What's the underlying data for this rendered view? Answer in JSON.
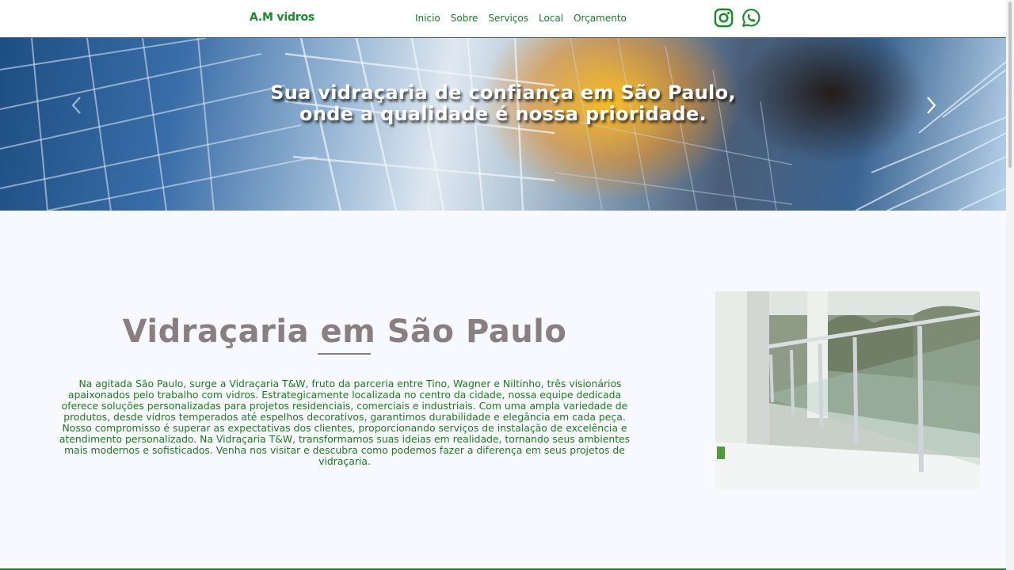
{
  "navbar": {
    "brand": "A.M vidros",
    "links": [
      {
        "label": "Inicio"
      },
      {
        "label": "Sobre"
      },
      {
        "label": "Serviços"
      },
      {
        "label": "Local"
      },
      {
        "label": "Orçamento"
      }
    ],
    "social": [
      {
        "icon": "instagram-icon"
      },
      {
        "icon": "whatsapp-icon"
      }
    ],
    "accent_color": "#1b8a2e"
  },
  "hero": {
    "caption": "Sua vidraçaria de confiança em São Paulo, onde a qualidade é nossa prioridade.",
    "prev_icon": "chevron-left-icon",
    "next_icon": "chevron-right-icon"
  },
  "about": {
    "title": "Vidraçaria em São Paulo",
    "text": "Na agitada São Paulo, surge a Vidraçaria T&W, fruto da parceria entre Tino, Wagner e Niltinho, três visionários apaixonados pelo trabalho com vidros. Estrategicamente localizada no centro da cidade, nossa equipe dedicada oferece soluções personalizadas para projetos residenciais, comerciais e industriais. Com uma ampla variedade de produtos, desde vidros temperados até espelhos decorativos, garantimos durabilidade e elegância em cada peça. Nosso compromisso é superar as expectativas dos clientes, proporcionando serviços de instalação de excelência e atendimento personalizado. Na Vidraçaria T&W, transformamos suas ideias em realidade, tornando seus ambientes mais modernos e sofisticados. Venha nos visitar e descubra como podemos fazer a diferença em seus projetos de vidraçaria.",
    "title_color": "#8a7f80",
    "text_color": "#1f7a1f"
  }
}
